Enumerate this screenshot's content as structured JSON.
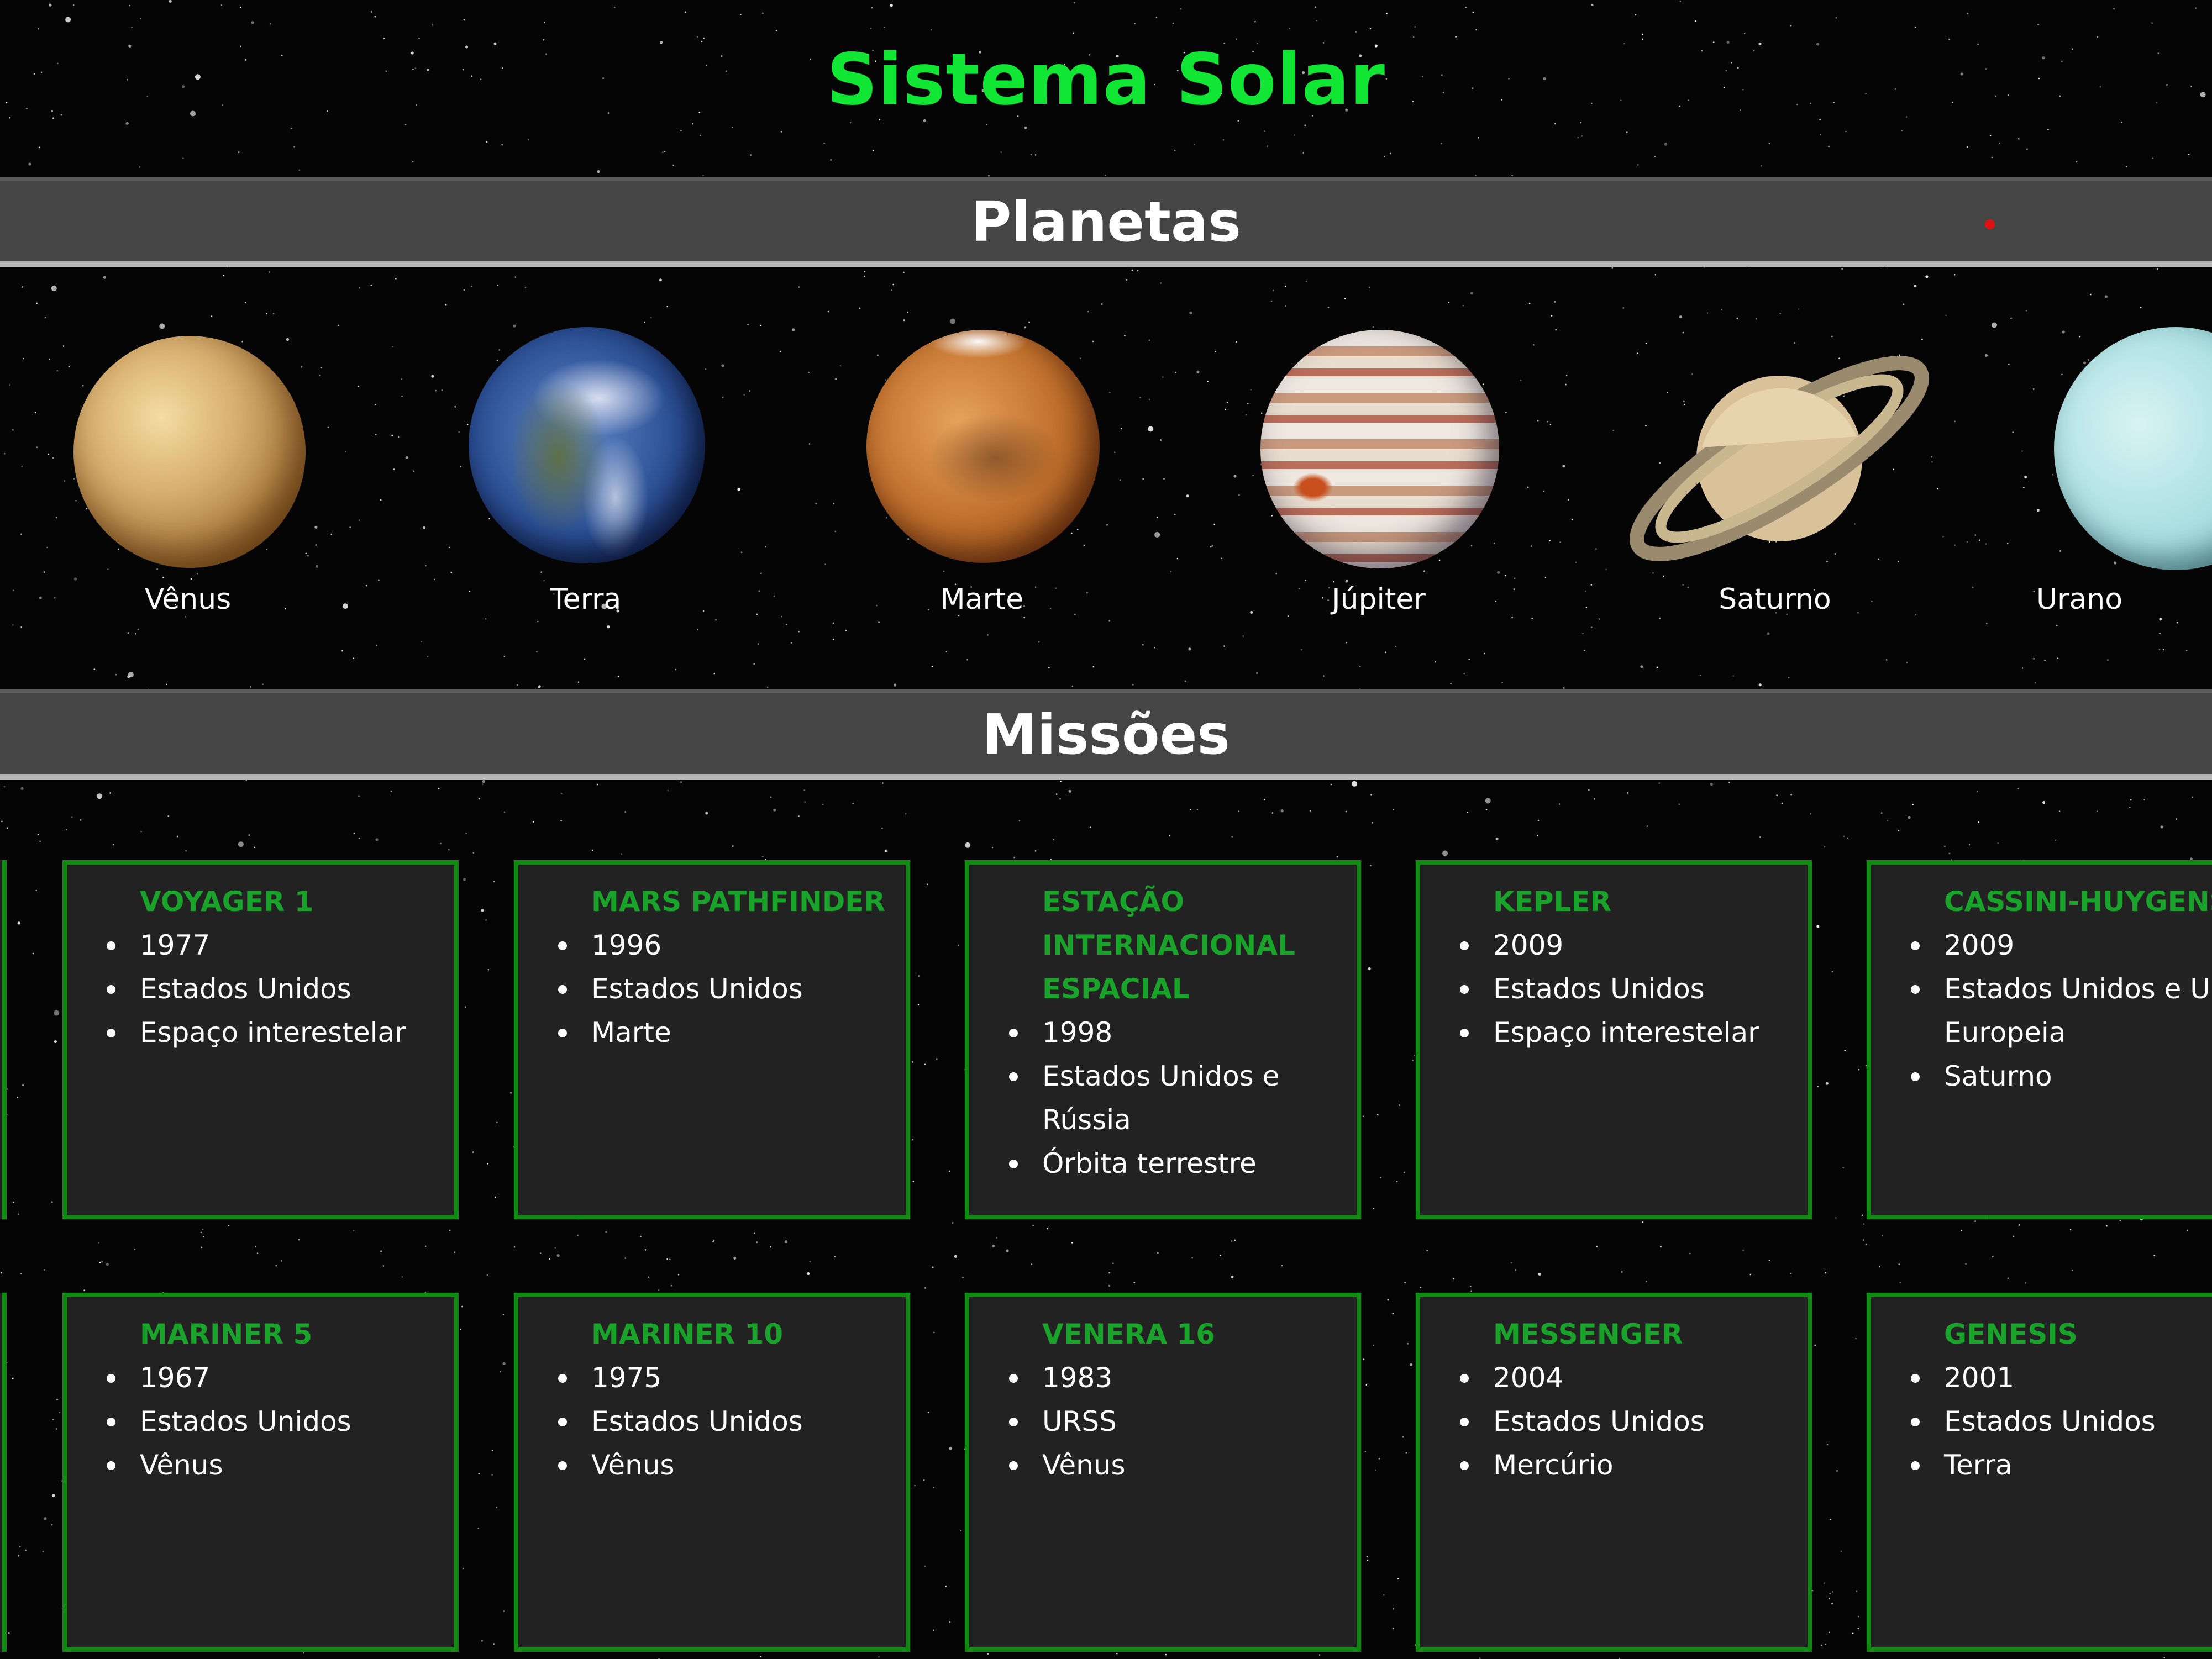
{
  "site_title": "Sistema Solar",
  "sections": {
    "planets_title": "Planetas",
    "missions_title": "Missões"
  },
  "planets": [
    {
      "name": "Vênus"
    },
    {
      "name": "Terra"
    },
    {
      "name": "Marte"
    },
    {
      "name": "Júpiter"
    },
    {
      "name": "Saturno"
    },
    {
      "name": "Urano"
    }
  ],
  "missions_row1": [
    {
      "title": "VOYAGER 1",
      "items": [
        "1977",
        "Estados Unidos",
        "Espaço interestelar"
      ]
    },
    {
      "title": "MARS PATHFINDER",
      "items": [
        "1996",
        "Estados Unidos",
        "Marte"
      ]
    },
    {
      "title": "ESTAÇÃO INTERNACIONAL ESPACIAL",
      "items": [
        "1998",
        "Estados Unidos e Rússia",
        "Órbita terrestre"
      ]
    },
    {
      "title": "KEPLER",
      "items": [
        "2009",
        "Estados Unidos",
        "Espaço interestelar"
      ]
    },
    {
      "title": "CASSINI-HUYGENS",
      "items": [
        "2009",
        "Estados Unidos e Uni",
        "Europeia",
        "Saturno"
      ]
    }
  ],
  "missions_row2": [
    {
      "title": "MARINER 5",
      "items": [
        "1967",
        "Estados Unidos",
        "Vênus"
      ]
    },
    {
      "title": "MARINER 10",
      "items": [
        "1975",
        "Estados Unidos",
        "Vênus"
      ]
    },
    {
      "title": "VENERA 16",
      "items": [
        "1983",
        "URSS",
        "Vênus"
      ]
    },
    {
      "title": "MESSENGER",
      "items": [
        "2004",
        "Estados Unidos",
        "Mercúrio"
      ]
    },
    {
      "title": "GENESIS",
      "items": [
        "2001",
        "Estados Unidos",
        "Terra"
      ]
    }
  ],
  "colors": {
    "title_green": "#11e635",
    "card_border": "#108a12",
    "card_title": "#1aa32b",
    "bar_bg": "#454545"
  }
}
